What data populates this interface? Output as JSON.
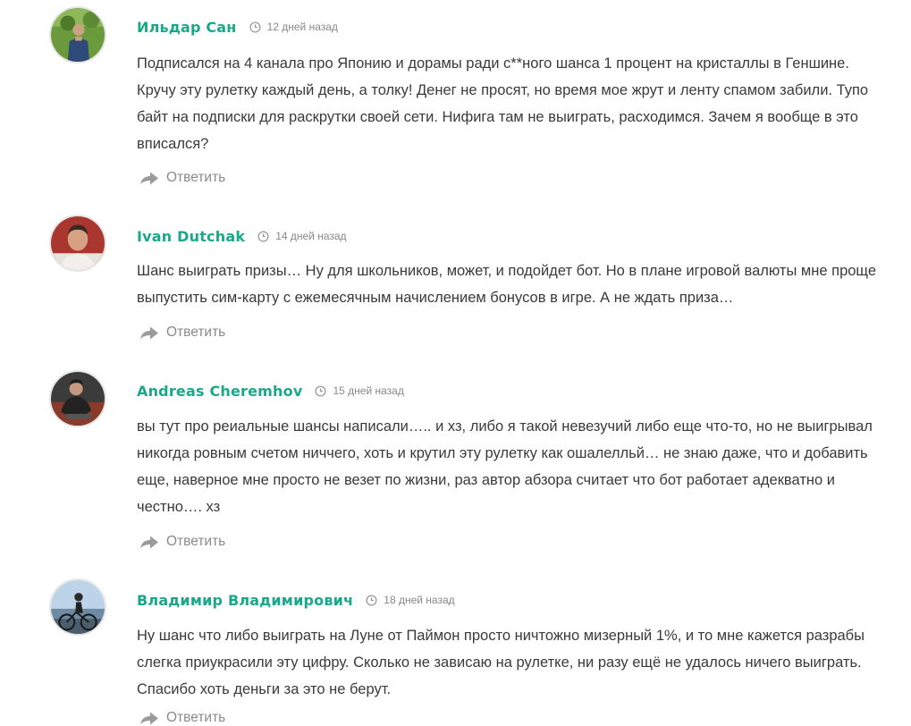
{
  "reply_label": "Ответить",
  "accent_color": "#1aa88a",
  "comments": [
    {
      "author": "Ильдар Сан",
      "date": "12 дней назад",
      "text": "Подписался на 4 канала про Японию и дорамы ради с**ного шанса 1 процент на кристаллы в Геншине. Кручу эту рулетку каждый день, а толку! Денег не просят, но время мое жрут и ленту спамом забили. Тупо байт на подписки для раскрутки своей сети. Нифига там не выиграть, расходимся. Зачем я вообще в это вписался?"
    },
    {
      "author": "Ivan Dutchak",
      "date": "14 дней назад",
      "text": "Шанс выиграть призы… Ну для школьников, может, и подойдет бот. Но в плане игровой валюты мне проще выпустить сим-карту с ежемесячным начислением бонусов в игре. А не ждать приза…"
    },
    {
      "author": "Andreas Cheremhov",
      "date": "15 дней назад",
      "text": "вы тут про реиальные шансы написали….. и хз, либо я такой невезучий либо еще что-то, но не выигрывал никогда ровным счетом ниччего, хоть и крутил эту рулетку как ошалелльй… не знаю даже, что и добавить еще, наверное мне просто не везет по жизни, раз автор абзора считает что бот работает адекватно и честно…. хз"
    },
    {
      "author": "Владимир Владимирович",
      "date": "18 дней назад",
      "text": "Ну шанс что либо выиграть на Луне от Паймон просто ничтожно мизерный 1%, и то мне кажется разрабы слегка приукрасили эту цифру. Сколько не зависаю на рулетке, ни разу ещё не удалось ничего выиграть. Спасибо хоть деньги за это не берут."
    }
  ]
}
